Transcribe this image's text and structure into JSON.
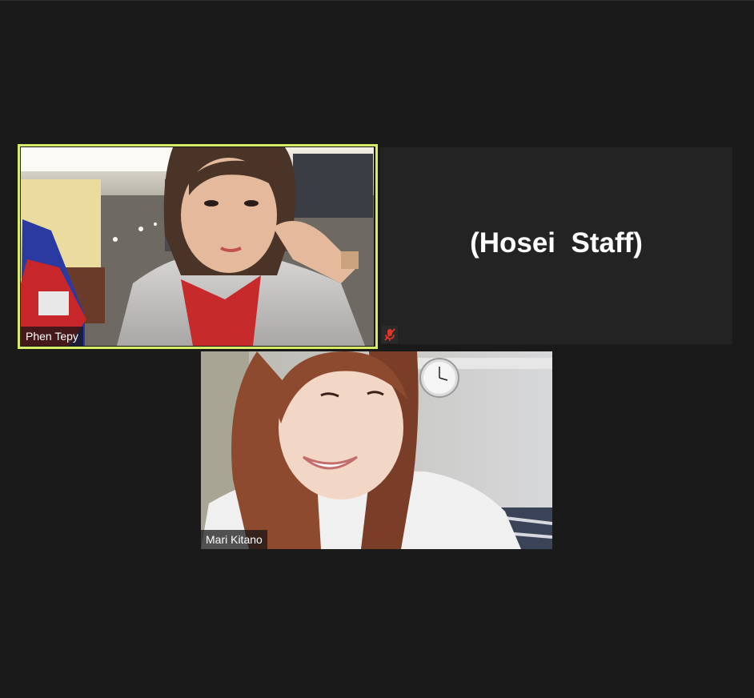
{
  "meeting": {
    "participants": [
      {
        "name": "Phen Tepy",
        "video": true,
        "active_speaker": true
      },
      {
        "name": "(Hosei  Staff)",
        "video": false,
        "muted": true
      },
      {
        "name": "Mari Kitano",
        "video": true
      }
    ]
  },
  "colors": {
    "background": "#1a1a1a",
    "tile_placeholder": "#232323",
    "active_speaker_border": "#d7ec62",
    "mute_red": "#e0352b"
  },
  "icons": {
    "muted": "microphone-muted-icon"
  }
}
